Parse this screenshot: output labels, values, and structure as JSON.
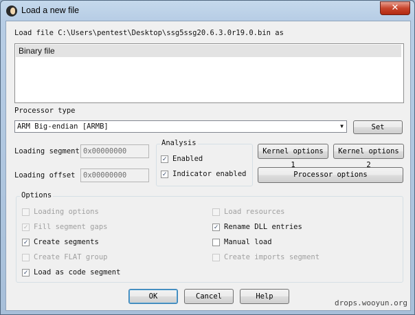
{
  "window": {
    "title": "Load a new file",
    "close_glyph": "✕"
  },
  "header": {
    "load_file_label": "Load file C:\\Users\\pentest\\Desktop\\ssg5ssg20.6.3.0r19.0.bin as"
  },
  "file_types": [
    "Binary file"
  ],
  "processor": {
    "label": "Processor type",
    "selected": "ARM Big-endian [ARMB]",
    "set_button": "Set"
  },
  "loading": {
    "segment_label": "Loading segment",
    "segment_value": "0x00000000",
    "offset_label": "Loading offset",
    "offset_value": "0x00000000"
  },
  "analysis": {
    "title": "Analysis",
    "enabled_label": "Enabled",
    "enabled_checked": true,
    "indicator_label": "Indicator enabled",
    "indicator_checked": true
  },
  "buttons": {
    "kernel1": "Kernel options 1",
    "kernel2": "Kernel options 2",
    "processor_options": "Processor options",
    "ok": "OK",
    "cancel": "Cancel",
    "help": "Help"
  },
  "options": {
    "title": "Options",
    "left": [
      {
        "label": "Loading options",
        "checked": false,
        "disabled": true
      },
      {
        "label": "Fill segment gaps",
        "checked": true,
        "disabled": true
      },
      {
        "label": "Create segments",
        "checked": true,
        "disabled": false
      },
      {
        "label": "Create FLAT group",
        "checked": false,
        "disabled": true
      },
      {
        "label": "Load as code segment",
        "checked": true,
        "disabled": false
      }
    ],
    "right": [
      {
        "label": "Load resources",
        "checked": false,
        "disabled": true
      },
      {
        "label": "Rename DLL entries",
        "checked": true,
        "disabled": false
      },
      {
        "label": "Manual load",
        "checked": false,
        "disabled": false
      },
      {
        "label": "Create imports segment",
        "checked": false,
        "disabled": true
      }
    ]
  },
  "watermark": "drops.wooyun.org",
  "colors": {
    "titlebar": "#b7cde5",
    "close_button": "#c8452c",
    "default_button_border": "#3c7fb1"
  }
}
